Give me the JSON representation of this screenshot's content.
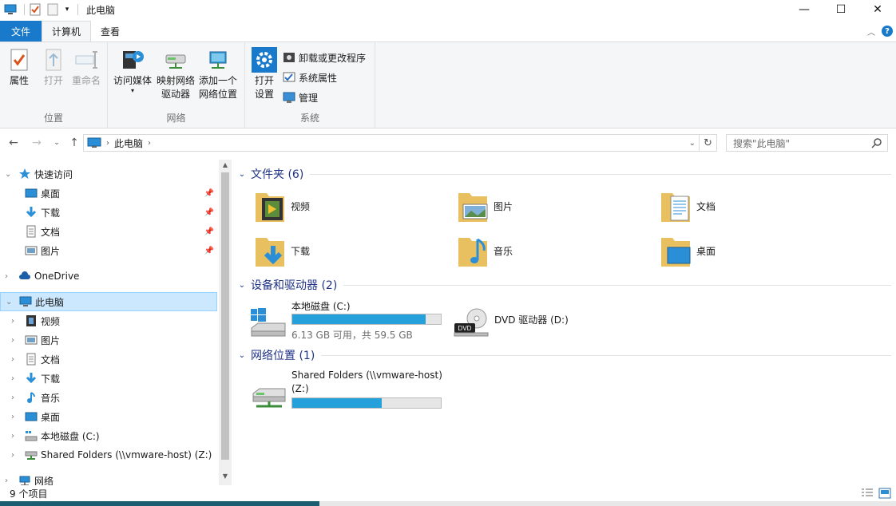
{
  "window": {
    "title": "此电脑",
    "controls": {
      "minimize": "—",
      "maximize": "☐",
      "close": "✕"
    }
  },
  "ribbon_tabs": [
    "文件",
    "计算机",
    "查看"
  ],
  "ribbon": {
    "location": {
      "label": "位置",
      "buttons": [
        "属性",
        "打开",
        "重命名"
      ]
    },
    "network": {
      "label": "网络",
      "access_media": "访问媒体",
      "map_drive_line1": "映射网络",
      "map_drive_line2": "驱动器",
      "add_location_line1": "添加一个",
      "add_location_line2": "网络位置"
    },
    "system": {
      "label": "系统",
      "open_settings_line1": "打开",
      "open_settings_line2": "设置",
      "uninstall": "卸载或更改程序",
      "system_properties": "系统属性",
      "manage": "管理"
    }
  },
  "address": {
    "crumb": "此电脑",
    "search_placeholder": "搜索\"此电脑\""
  },
  "nav": {
    "quick_access": "快速访问",
    "quick_items": [
      "桌面",
      "下载",
      "文档",
      "图片"
    ],
    "onedrive": "OneDrive",
    "this_pc": "此电脑",
    "pc_items": [
      "视频",
      "图片",
      "文档",
      "下载",
      "音乐",
      "桌面",
      "本地磁盘 (C:)",
      "Shared Folders (\\\\vmware-host) (Z:)"
    ],
    "network": "网络"
  },
  "content": {
    "folders_header": "文件夹 (6)",
    "folders": [
      "视频",
      "图片",
      "文档",
      "下载",
      "音乐",
      "桌面"
    ],
    "devices_header": "设备和驱动器 (2)",
    "drive_c": {
      "name": "本地磁盘 (C:)",
      "size": "6.13 GB 可用，共 59.5 GB",
      "used_fraction": 0.9
    },
    "drive_d": {
      "name": "DVD 驱动器 (D:)"
    },
    "network_header": "网络位置 (1)",
    "share": {
      "name_line1": "Shared Folders (\\\\vmware-host)",
      "name_line2": "(Z:)",
      "used_fraction": 0.6
    }
  },
  "status": {
    "items": "9 个项目"
  },
  "colors": {
    "accent": "#1979ca",
    "selection": "#cce8ff",
    "bar_fill": "#26a0da",
    "section_title": "#1e3287"
  }
}
